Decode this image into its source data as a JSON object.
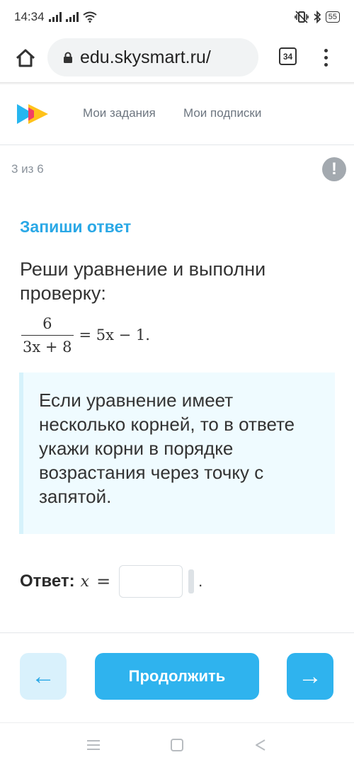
{
  "status_bar": {
    "time": "14:34",
    "battery": "55"
  },
  "browser": {
    "url": "edu.skysmart.ru/",
    "tab_count": "34"
  },
  "nav": {
    "links": [
      "Мои задания",
      "Мои подписки"
    ]
  },
  "task": {
    "progress": "3 из 6",
    "alert_label": "!",
    "title": "Запиши ответ",
    "prompt": "Реши уравнение и выполни проверку:",
    "equation": {
      "numerator": "6",
      "denominator": "3x + 8",
      "rhs": "= 5x − 1."
    },
    "hint": "Если уравнение имеет несколько корней, то в ответе укажи корни в порядке возрастания через точку с запятой."
  },
  "answer": {
    "label": "Ответ:",
    "variable": "x",
    "equals": "=",
    "value": "",
    "suffix": "."
  },
  "actions": {
    "prev_icon": "←",
    "continue_label": "Продолжить",
    "next_icon": "→"
  },
  "colors": {
    "accent": "#2fb3ee",
    "title": "#2aa8e6",
    "hint_bg": "#effbff",
    "prev_bg": "#d9f1fc"
  }
}
